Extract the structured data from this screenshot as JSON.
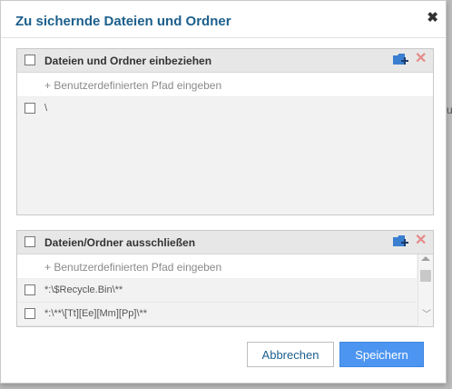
{
  "dialog": {
    "title": "Zu sichernde Dateien und Ordner",
    "close_symbol": "✖"
  },
  "behind_fragment": "ru",
  "include_panel": {
    "title": "Dateien und Ordner einbeziehen",
    "add_link": "+ Benutzerdefinierten Pfad eingeben",
    "items": [
      {
        "label": "\\"
      }
    ],
    "icons": [
      "add-folder-icon",
      "delete-icon"
    ]
  },
  "exclude_panel": {
    "title": "Dateien/Ordner ausschließen",
    "add_link": "+ Benutzerdefinierten Pfad eingeben",
    "items": [
      {
        "label": "*:\\$Recycle.Bin\\**"
      },
      {
        "label": "*:\\**\\[Tt][Ee][Mm][Pp]\\**"
      }
    ],
    "icons": [
      "add-folder-icon",
      "delete-icon"
    ]
  },
  "buttons": {
    "cancel": "Abbrechen",
    "save": "Speichern"
  },
  "colors": {
    "title": "#1c5f8c",
    "primary": "#4c95f0",
    "delete_icon": "#e58a8a",
    "folder_icon": "#3a7fd0"
  }
}
